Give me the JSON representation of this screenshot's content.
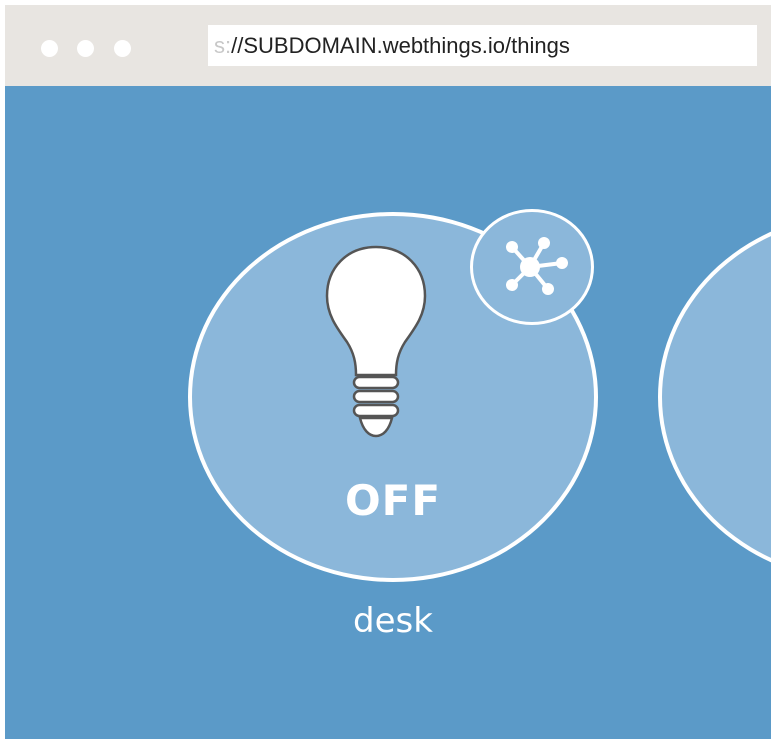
{
  "browser": {
    "url_prefix": "s:",
    "url_main": "//SUBDOMAIN.webthings.io/things"
  },
  "things": [
    {
      "name": "desk",
      "state": "OFF",
      "icon": "light-bulb-icon",
      "badge_icon": "thing-network-icon"
    }
  ],
  "colors": {
    "chrome": "#e8e5e1",
    "background": "#5b9ac8",
    "tile": "#8bb7da",
    "accent": "#ffffff"
  }
}
